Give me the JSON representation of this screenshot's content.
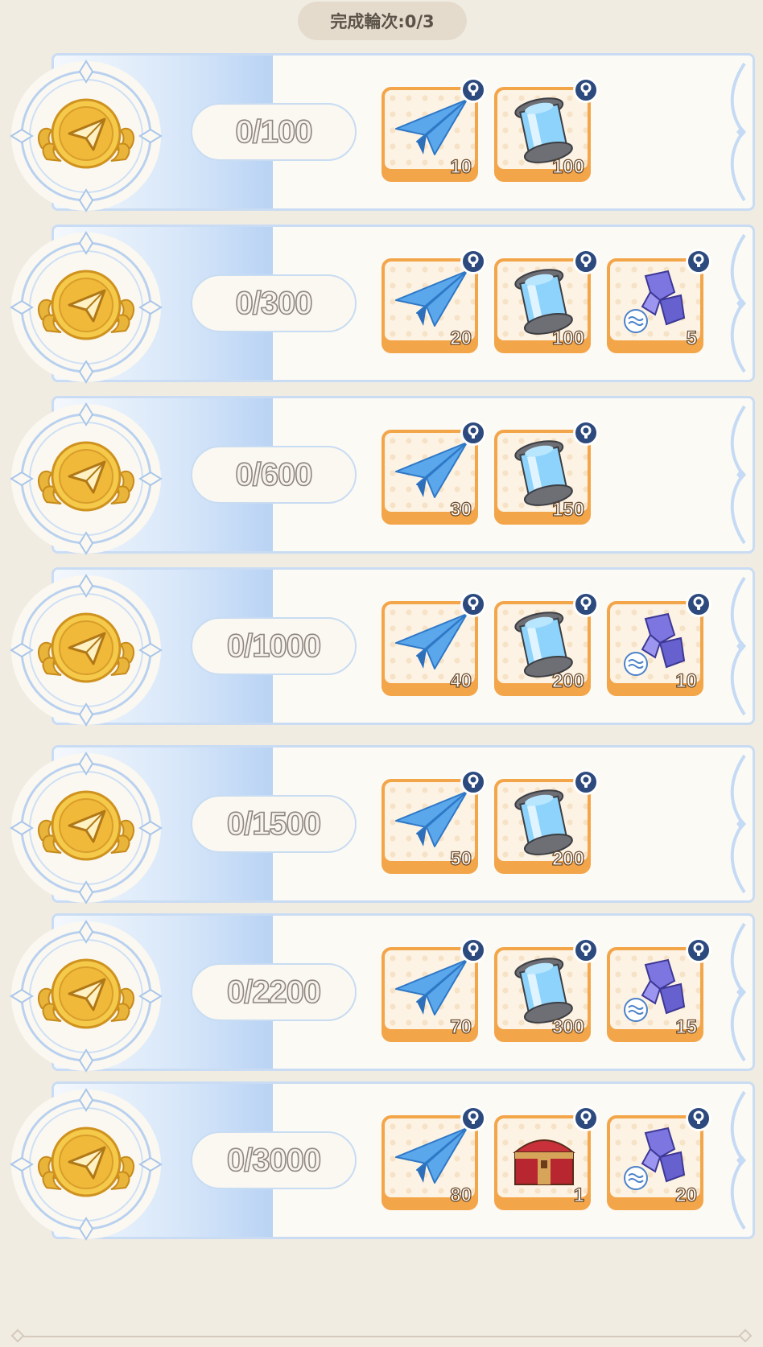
{
  "header": {
    "round_label": "完成輪次:0/3"
  },
  "colors": {
    "background": "#f1ece2",
    "card_border": "#c9dcf3",
    "item_frame": "#f3a54a",
    "lock_badge": "#2d4a7e"
  },
  "tiers": [
    {
      "progress": "0/100",
      "rewards": [
        {
          "icon": "paper-plane-icon",
          "qty": "10"
        },
        {
          "icon": "energy-canister-icon",
          "qty": "100"
        }
      ]
    },
    {
      "progress": "0/300",
      "rewards": [
        {
          "icon": "paper-plane-icon",
          "qty": "20"
        },
        {
          "icon": "energy-canister-icon",
          "qty": "100"
        },
        {
          "icon": "crystal-shard-icon",
          "qty": "5"
        }
      ]
    },
    {
      "progress": "0/600",
      "rewards": [
        {
          "icon": "paper-plane-icon",
          "qty": "30"
        },
        {
          "icon": "energy-canister-icon",
          "qty": "150"
        }
      ]
    },
    {
      "progress": "0/1000",
      "rewards": [
        {
          "icon": "paper-plane-icon",
          "qty": "40"
        },
        {
          "icon": "energy-canister-icon",
          "qty": "200"
        },
        {
          "icon": "crystal-shard-icon",
          "qty": "10"
        }
      ]
    },
    {
      "progress": "0/1500",
      "rewards": [
        {
          "icon": "paper-plane-icon",
          "qty": "50"
        },
        {
          "icon": "energy-canister-icon",
          "qty": "200"
        }
      ]
    },
    {
      "progress": "0/2200",
      "rewards": [
        {
          "icon": "paper-plane-icon",
          "qty": "70"
        },
        {
          "icon": "energy-canister-icon",
          "qty": "300"
        },
        {
          "icon": "crystal-shard-icon",
          "qty": "15"
        }
      ]
    },
    {
      "progress": "0/3000",
      "rewards": [
        {
          "icon": "paper-plane-icon",
          "qty": "80"
        },
        {
          "icon": "treasure-chest-icon",
          "qty": "1"
        },
        {
          "icon": "crystal-shard-icon",
          "qty": "20"
        }
      ]
    }
  ]
}
